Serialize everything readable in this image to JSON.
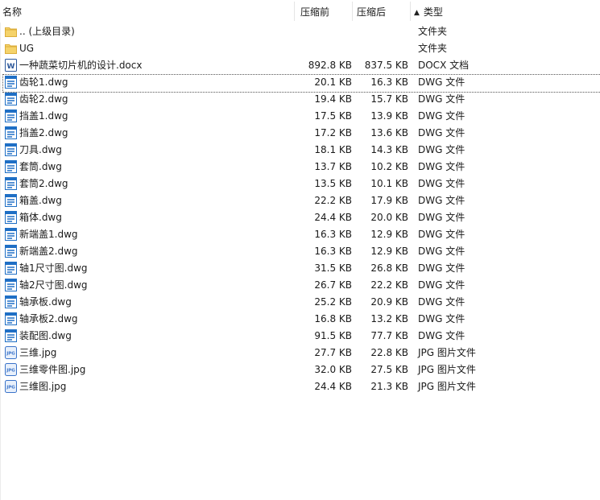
{
  "columns": {
    "name": "名称",
    "before": "压缩前",
    "after": "压缩后",
    "type": "类型",
    "sort_arrow": "▲"
  },
  "rows": [
    {
      "name": ".. (上级目录)",
      "before": "",
      "after": "",
      "type": "文件夹",
      "icon": "folder-icon"
    },
    {
      "name": "UG",
      "before": "",
      "after": "",
      "type": "文件夹",
      "icon": "folder-icon"
    },
    {
      "name": "一种蔬菜切片机的设计.docx",
      "before": "892.8 KB",
      "after": "837.5 KB",
      "type": "DOCX 文档",
      "icon": "word-doc-icon"
    },
    {
      "name": "齿轮1.dwg",
      "before": "20.1 KB",
      "after": "16.3 KB",
      "type": "DWG 文件",
      "icon": "dwg-file-icon"
    },
    {
      "name": "齿轮2.dwg",
      "before": "19.4 KB",
      "after": "15.7 KB",
      "type": "DWG 文件",
      "icon": "dwg-file-icon"
    },
    {
      "name": "挡盖1.dwg",
      "before": "17.5 KB",
      "after": "13.9 KB",
      "type": "DWG 文件",
      "icon": "dwg-file-icon"
    },
    {
      "name": "挡盖2.dwg",
      "before": "17.2 KB",
      "after": "13.6 KB",
      "type": "DWG 文件",
      "icon": "dwg-file-icon"
    },
    {
      "name": "刀具.dwg",
      "before": "18.1 KB",
      "after": "14.3 KB",
      "type": "DWG 文件",
      "icon": "dwg-file-icon"
    },
    {
      "name": "套筒.dwg",
      "before": "13.7 KB",
      "after": "10.2 KB",
      "type": "DWG 文件",
      "icon": "dwg-file-icon"
    },
    {
      "name": "套筒2.dwg",
      "before": "13.5 KB",
      "after": "10.1 KB",
      "type": "DWG 文件",
      "icon": "dwg-file-icon"
    },
    {
      "name": "箱盖.dwg",
      "before": "22.2 KB",
      "after": "17.9 KB",
      "type": "DWG 文件",
      "icon": "dwg-file-icon"
    },
    {
      "name": "箱体.dwg",
      "before": "24.4 KB",
      "after": "20.0 KB",
      "type": "DWG 文件",
      "icon": "dwg-file-icon"
    },
    {
      "name": "新端盖1.dwg",
      "before": "16.3 KB",
      "after": "12.9 KB",
      "type": "DWG 文件",
      "icon": "dwg-file-icon"
    },
    {
      "name": "新端盖2.dwg",
      "before": "16.3 KB",
      "after": "12.9 KB",
      "type": "DWG 文件",
      "icon": "dwg-file-icon"
    },
    {
      "name": "轴1尺寸图.dwg",
      "before": "31.5 KB",
      "after": "26.8 KB",
      "type": "DWG 文件",
      "icon": "dwg-file-icon"
    },
    {
      "name": "轴2尺寸图.dwg",
      "before": "26.7 KB",
      "after": "22.2 KB",
      "type": "DWG 文件",
      "icon": "dwg-file-icon"
    },
    {
      "name": "轴承板.dwg",
      "before": "25.2 KB",
      "after": "20.9 KB",
      "type": "DWG 文件",
      "icon": "dwg-file-icon"
    },
    {
      "name": "轴承板2.dwg",
      "before": "16.8 KB",
      "after": "13.2 KB",
      "type": "DWG 文件",
      "icon": "dwg-file-icon"
    },
    {
      "name": "装配图.dwg",
      "before": "91.5 KB",
      "after": "77.7 KB",
      "type": "DWG 文件",
      "icon": "dwg-file-icon"
    },
    {
      "name": "三维.jpg",
      "before": "27.7 KB",
      "after": "22.8 KB",
      "type": "JPG 图片文件",
      "icon": "jpg-file-icon"
    },
    {
      "name": "三维零件图.jpg",
      "before": "32.0 KB",
      "after": "27.5 KB",
      "type": "JPG 图片文件",
      "icon": "jpg-file-icon"
    },
    {
      "name": "三维图.jpg",
      "before": "24.4 KB",
      "after": "21.3 KB",
      "type": "JPG 图片文件",
      "icon": "jpg-file-icon"
    }
  ],
  "focused_row": 3,
  "colors": {
    "folder": "#f5d36a",
    "folder_edge": "#dcae3a",
    "dwg": "#1f6fc5",
    "word": "#2b579a",
    "jpg": "#3a73c9"
  }
}
